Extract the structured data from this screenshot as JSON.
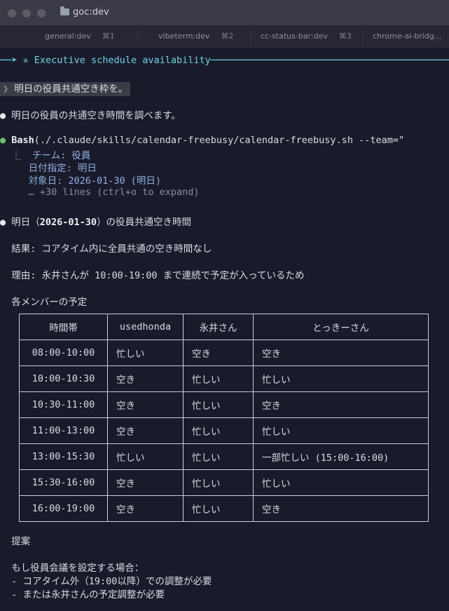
{
  "window": {
    "title": "goc:dev"
  },
  "tabs": [
    {
      "label": "general:dev",
      "key": "⌘1"
    },
    {
      "label": "vibeterm:dev",
      "key": "⌘2"
    },
    {
      "label": "cc-status-bar:dev",
      "key": "⌘3"
    },
    {
      "label": "chrome-ai-bridg…"
    }
  ],
  "terminal": {
    "session_title": "✳ Executive schedule availability",
    "prompt": "明日の役員共通空き枠を。",
    "assistant_intro": "明日の役員の共通空き時間を調べます。",
    "bash_label": "Bash",
    "bash_command": "(./.claude/skills/calendar-freebusy/calendar-freebusy.sh --team=\"",
    "bash_output": [
      "チーム: 役員",
      "日付指定: 明日",
      "対象日: 2026-01-30 (明日)"
    ],
    "more_lines": "… +30 lines (ctrl+o to expand)",
    "result_heading_pre": "明日（",
    "result_heading_date": "2026-01-30",
    "result_heading_post": "）の役員共通空き時間",
    "result_line": "結果: コアタイム内に全員共通の空き時間なし",
    "reason_line": "理由: 永井さんが 10:00-19:00 まで連続で予定が入っているため",
    "members_heading": "各メンバーの予定",
    "table": {
      "headers": [
        "時間帯",
        "usedhonda",
        "永井さん",
        "とっきーさん"
      ],
      "rows": [
        [
          "08:00-10:00",
          "忙しい",
          "空き",
          "空き"
        ],
        [
          "10:00-10:30",
          "空き",
          "忙しい",
          "忙しい"
        ],
        [
          "10:30-11:00",
          "空き",
          "忙しい",
          "空き"
        ],
        [
          "11:00-13:00",
          "空き",
          "忙しい",
          "忙しい"
        ],
        [
          "13:00-15:30",
          "忙しい",
          "忙しい",
          "一部忙しい (15:00-16:00)"
        ],
        [
          "15:30-16:00",
          "空き",
          "忙しい",
          "忙しい"
        ],
        [
          "16:00-19:00",
          "空き",
          "忙しい",
          "空き"
        ]
      ]
    },
    "proposal_heading": "提案",
    "proposal_intro": "もし役員会議を設定する場合：",
    "proposal_items": [
      "- コアタイム外（19:00以降）での調整が必要",
      "- または永井さんの予定調整が必要"
    ]
  }
}
